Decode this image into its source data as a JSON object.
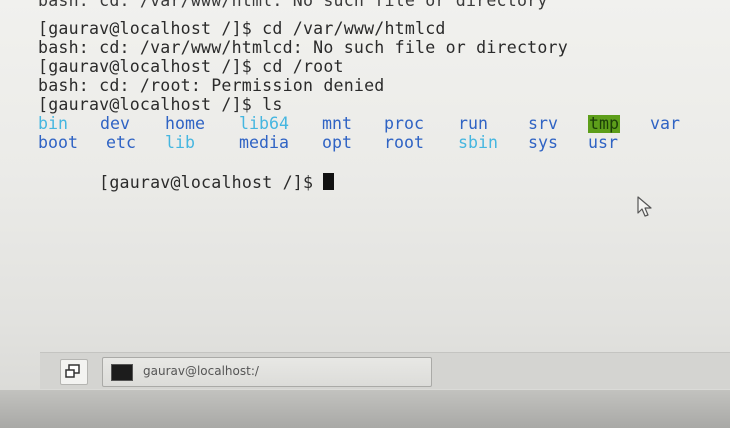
{
  "terminal": {
    "cut_line": "bash: cd: /var/www/html: No such file or directory",
    "lines": [
      "[gaurav@localhost /]$ cd /var/www/htmlcd",
      "bash: cd: /var/www/htmlcd: No such file or directory",
      "[gaurav@localhost /]$ cd /root",
      "bash: cd: /root: Permission denied",
      "[gaurav@localhost /]$ ls"
    ],
    "ls_row1": [
      {
        "name": "bin",
        "type": "link"
      },
      {
        "name": "dev",
        "type": "dir"
      },
      {
        "name": "home",
        "type": "dir"
      },
      {
        "name": "lib64",
        "type": "link"
      },
      {
        "name": "mnt",
        "type": "dir"
      },
      {
        "name": "proc",
        "type": "dir"
      },
      {
        "name": "run",
        "type": "dir"
      },
      {
        "name": "srv",
        "type": "dir"
      },
      {
        "name": "tmp",
        "type": "tmp"
      },
      {
        "name": "var",
        "type": "dir"
      }
    ],
    "ls_row2": [
      {
        "name": "boot",
        "type": "dir"
      },
      {
        "name": "etc",
        "type": "dir"
      },
      {
        "name": "lib",
        "type": "link"
      },
      {
        "name": "media",
        "type": "dir"
      },
      {
        "name": "opt",
        "type": "dir"
      },
      {
        "name": "root",
        "type": "dir"
      },
      {
        "name": "sbin",
        "type": "link"
      },
      {
        "name": "sys",
        "type": "dir"
      },
      {
        "name": "usr",
        "type": "dir"
      }
    ],
    "prompt": "[gaurav@localhost /]$ "
  },
  "taskbar": {
    "show_desktop_icon": "show-desktop-icon",
    "task_icon": "terminal-icon",
    "task_label": "gaurav@localhost:/"
  },
  "colors": {
    "symlink": "#45b6e0",
    "directory": "#2f63c4",
    "sticky_dir_bg": "#5d9e1a"
  }
}
